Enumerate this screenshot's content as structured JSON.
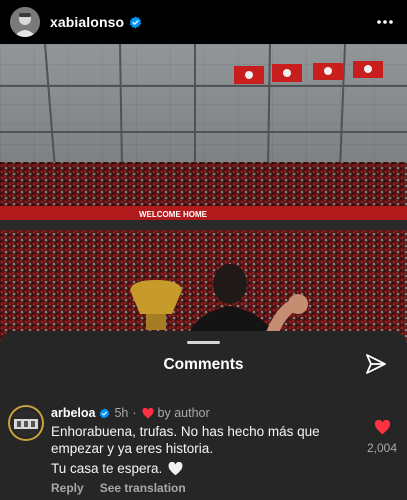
{
  "post": {
    "username": "xabialonso",
    "verified_icon": "verified-badge-icon",
    "more_icon": "more-options-icon",
    "photo": {
      "banner_text": "WELCOME HOME"
    }
  },
  "comments_sheet": {
    "title": "Comments",
    "share_icon": "send-icon",
    "comment": {
      "username": "arbeloa",
      "time": "5h",
      "separator": "·",
      "author_label": "by author",
      "text": "Enhorabuena, trufas. No has hecho más que empezar y ya eres historia.",
      "text_line2": "Tu casa te espera.",
      "reply_label": "Reply",
      "translation_label": "See translation",
      "like_count": "2,004",
      "liked": true
    }
  },
  "colors": {
    "background": "#000000",
    "sheet": "#262626",
    "verified": "#0095f6",
    "like": "#ff3040",
    "muted_text": "#a8a8a8"
  }
}
